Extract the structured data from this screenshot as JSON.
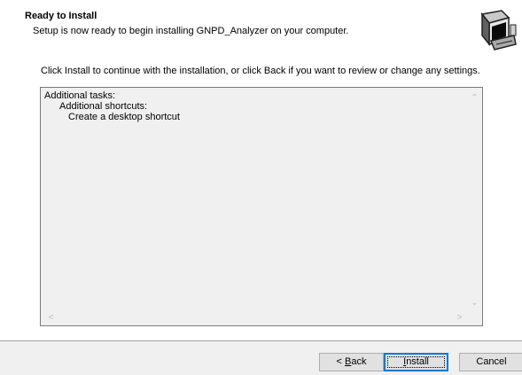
{
  "header": {
    "title": "Ready to Install",
    "subtitle": "Setup is now ready to begin installing GNPD_Analyzer on your computer.",
    "logo_icon": "setup-computer-icon"
  },
  "main": {
    "instruction": "Click Install to continue with the installation, or click Back if you want to review or change any settings.",
    "memo_lines": [
      "Additional tasks:",
      "Additional shortcuts:",
      "Create a desktop shortcut"
    ]
  },
  "buttons": {
    "back": {
      "prefix": "< ",
      "accel": "B",
      "rest": "ack"
    },
    "install": {
      "prefix": "",
      "accel": "I",
      "rest": "nstall"
    },
    "cancel": {
      "label": "Cancel"
    }
  },
  "colors": {
    "window_bg": "#f0f0f0",
    "panel_bg": "#ffffff",
    "focus_border": "#0078d7"
  }
}
